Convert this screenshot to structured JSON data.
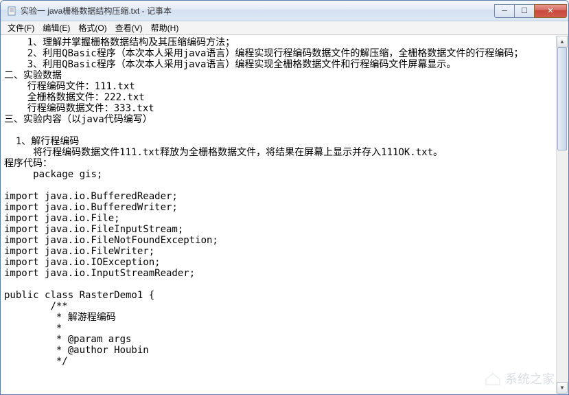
{
  "window": {
    "title": "实验一 java栅格数据结构压缩.txt - 记事本"
  },
  "menu": {
    "file": "文件(F)",
    "edit": "编辑(E)",
    "format": "格式(O)",
    "view": "查看(V)",
    "help": "帮助(H)"
  },
  "controls": {
    "min": "─",
    "max": "☐",
    "close": "✕"
  },
  "document": {
    "text": "    1、理解并掌握栅格数据结构及其压缩编码方法；\n    2、利用QBasic程序（本次本人采用java语言）编程实现行程编码数据文件的解压缩，全栅格数据文件的行程编码；\n    3、利用QBasic程序（本次本人采用java语言）编程实现全栅格数据文件和行程编码文件屏幕显示。\n二、实验数据\n    行程编码文件：111.txt\n    全栅格数据文件：222.txt\n    行程编码数据文件：333.txt\n三、实验内容（以java代码编写）\n\n  1、解行程编码\n     将行程编码数据文件111.txt释放为全栅格数据文件，将结果在屏幕上显示并存入111OK.txt。\n程序代码：\n     package gis;\n\nimport java.io.BufferedReader;\nimport java.io.BufferedWriter;\nimport java.io.File;\nimport java.io.FileInputStream;\nimport java.io.FileNotFoundException;\nimport java.io.FileWriter;\nimport java.io.IOException;\nimport java.io.InputStreamReader;\n\npublic class RasterDemo1 {\n        /**\n         * 解游程编码\n         *\n         * @param args\n         * @author Houbin\n         */"
  },
  "watermark": {
    "text": "系统之家"
  }
}
